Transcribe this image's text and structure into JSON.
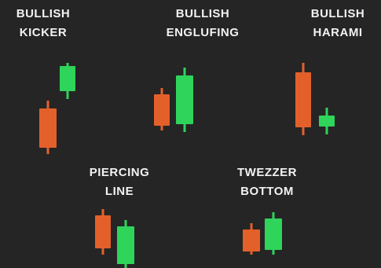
{
  "colors": {
    "background": "#252525",
    "text": "#f2f2f2",
    "bearish": "#e4602a",
    "bullish": "#2fd45b"
  },
  "patterns": [
    {
      "id": "bullish-kicker",
      "line1": "BULLISH",
      "line2": "KICKER"
    },
    {
      "id": "bullish-engulfing",
      "line1": "BULLISH",
      "line2": "ENGLUFING"
    },
    {
      "id": "bullish-harami",
      "line1": "BULLISH",
      "line2": "HARAMI"
    },
    {
      "id": "piercing-line",
      "line1": "PIERCING",
      "line2": "LINE"
    },
    {
      "id": "tweezer-bottom",
      "line1": "TWEZZER",
      "line2": "BOTTOM"
    }
  ]
}
